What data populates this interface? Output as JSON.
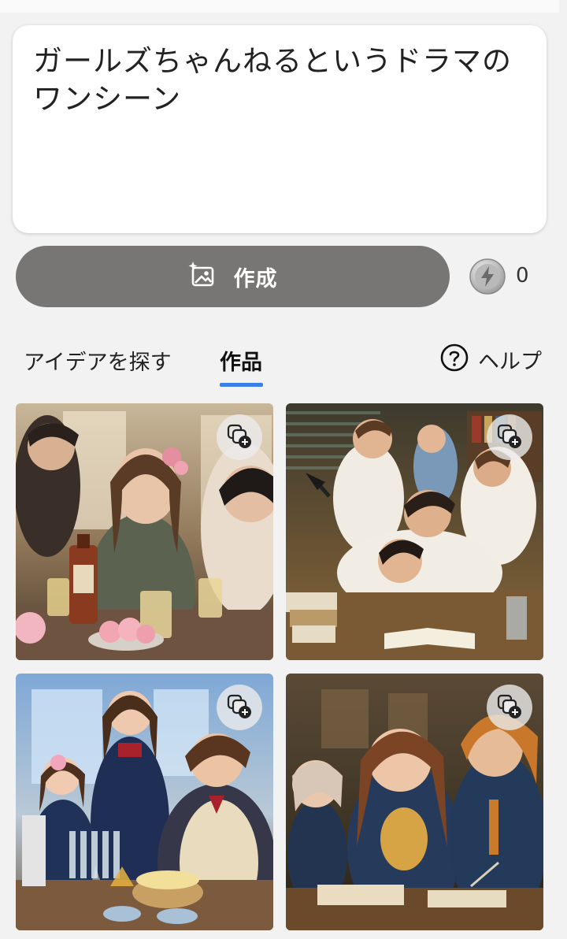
{
  "prompt": {
    "text": "ガールズちゃんねるというドラマのワンシーン"
  },
  "actions": {
    "create_label": "作成",
    "coin_count": "0"
  },
  "tabs": [
    {
      "label": "アイデアを探す",
      "selected": false
    },
    {
      "label": "作品",
      "selected": true
    }
  ],
  "help": {
    "label": "ヘルプ"
  },
  "colors": {
    "accent": "#3a7ee8",
    "create_button": "#777674"
  },
  "gallery": {
    "items": [
      {
        "icon": "add-to-collection-icon"
      },
      {
        "icon": "add-to-collection-icon"
      },
      {
        "icon": "add-to-collection-icon"
      },
      {
        "icon": "add-to-collection-icon"
      }
    ]
  }
}
